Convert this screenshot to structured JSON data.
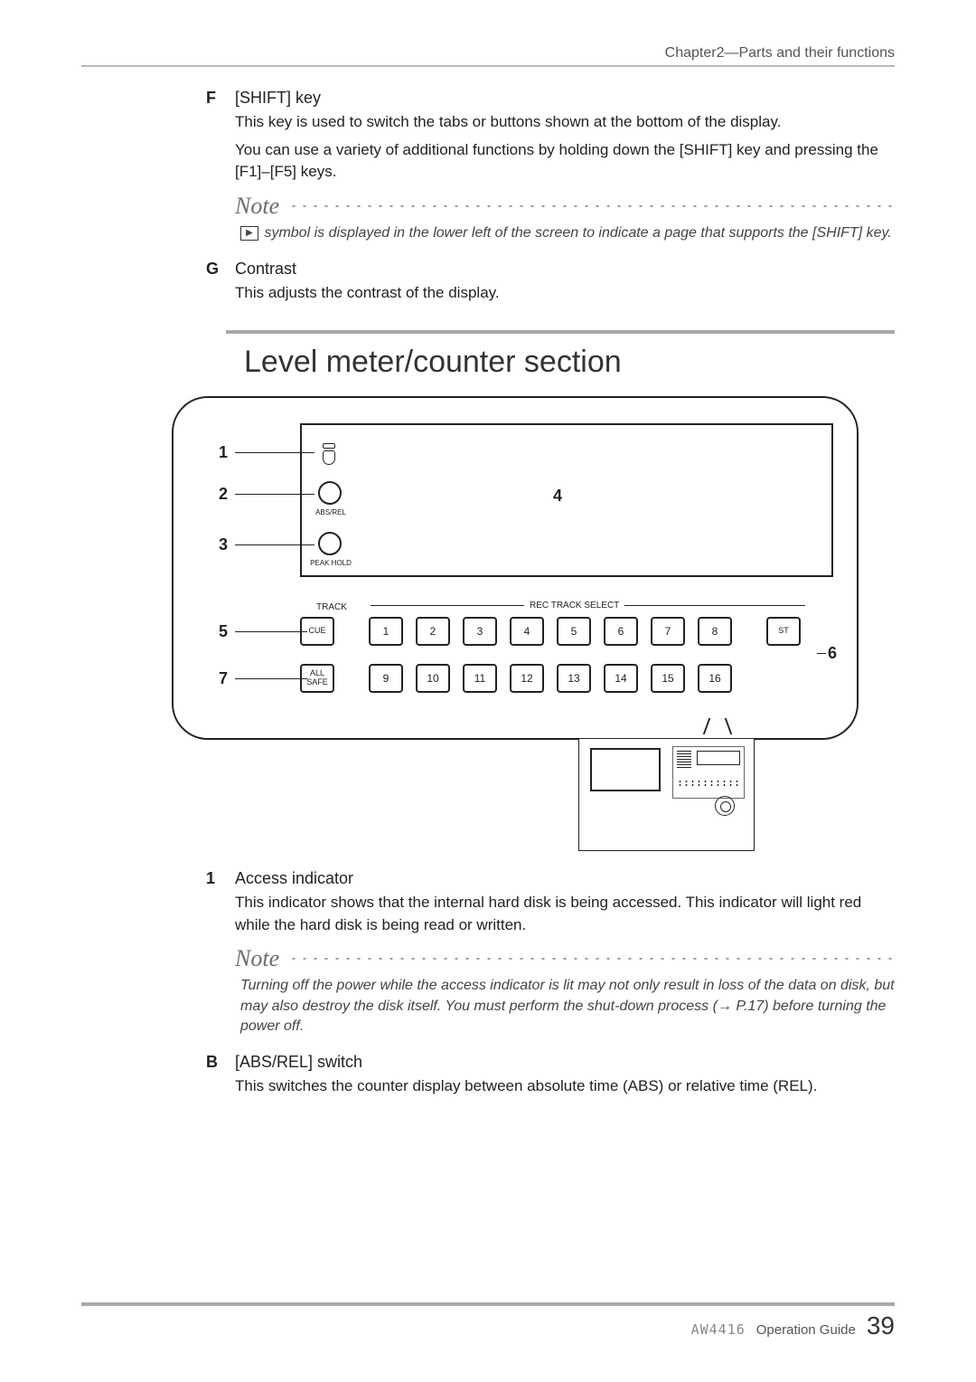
{
  "header": {
    "chapter": "Chapter2—Parts and their functions"
  },
  "items": {
    "F": {
      "letter": "F",
      "title": "[SHIFT] key",
      "p1": "This key is used to switch the tabs or buttons shown at the bottom of the display.",
      "p2": "You can use a variety of additional functions by holding down the [SHIFT] key and pressing the [F1]–[F5] keys.",
      "note_label": "Note",
      "note_symbol": "▶",
      "note_text": " symbol is displayed in the lower left of the screen to indicate a page that supports the [SHIFT] key."
    },
    "G": {
      "letter": "G",
      "title": "Contrast",
      "p1": "This adjusts the contrast of the display."
    }
  },
  "section": {
    "title": "Level meter/counter section"
  },
  "diagram": {
    "callouts": {
      "c1": "1",
      "c2": "2",
      "c3": "3",
      "c4": "4",
      "c5": "5",
      "c6": "6",
      "c7": "7"
    },
    "labels": {
      "abs": "ABS/REL",
      "peak": "PEAK HOLD",
      "track": "TRACK",
      "rec": "REC TRACK SELECT"
    },
    "keys": {
      "cue": "CUE",
      "allsafe": "ALL\nSAFE",
      "st": "ST",
      "k1": "1",
      "k2": "2",
      "k3": "3",
      "k4": "4",
      "k5": "5",
      "k6": "6",
      "k7": "7",
      "k8": "8",
      "k9": "9",
      "k10": "10",
      "k11": "11",
      "k12": "12",
      "k13": "13",
      "k14": "14",
      "k15": "15",
      "k16": "16"
    }
  },
  "lower_items": {
    "one": {
      "letter": "1",
      "title": "Access indicator",
      "p1": "This indicator shows that the internal hard disk is being accessed. This indicator will light red while the hard disk is being read or written.",
      "note_label": "Note",
      "note_text": "Turning off the power while the access indicator is lit may not only result in loss of the data on disk, but may also destroy the disk itself. You must perform the shut-down process (→ P.17) before turning the power off."
    },
    "B": {
      "letter": "B",
      "title": "[ABS/REL] switch",
      "p1": "This switches the counter display between absolute time (ABS) or relative time (REL)."
    }
  },
  "footer": {
    "logo": "AW4416",
    "guide": "Operation Guide",
    "page": "39"
  }
}
